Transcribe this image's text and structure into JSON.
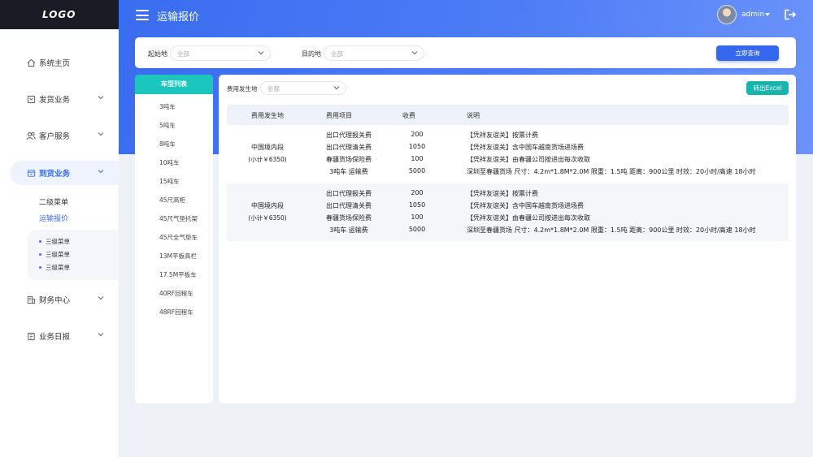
{
  "logo": "LOGO",
  "header": {
    "title": "运输报价",
    "user": "admin"
  },
  "sidebar": {
    "items": [
      {
        "label": "系统主页",
        "icon": "home-icon",
        "has_chevron": false
      },
      {
        "label": "发货业务",
        "icon": "shipping-icon",
        "has_chevron": true
      },
      {
        "label": "客户服务",
        "icon": "users-icon",
        "has_chevron": true
      },
      {
        "label": "到货业务",
        "icon": "arrival-icon",
        "has_chevron": true,
        "active": true
      },
      {
        "label": "财务中心",
        "icon": "finance-icon",
        "has_chevron": true
      },
      {
        "label": "业务日报",
        "icon": "report-icon",
        "has_chevron": true
      }
    ],
    "sub_items": [
      "二级菜单",
      "运输报价"
    ],
    "sub_sub_items": [
      "三级菜单",
      "三级菜单",
      "三级菜单"
    ]
  },
  "filter": {
    "origin_label": "起始地",
    "origin_value": "全部",
    "dest_label": "目的地",
    "dest_value": "全部",
    "query_button": "立即查询"
  },
  "vehicles": {
    "title": "车型列表",
    "items": [
      "3吨车",
      "5吨车",
      "8吨车",
      "10吨车",
      "15吨车",
      "45尺高柜",
      "45尺气垫托架",
      "45尺全气垫车",
      "13M平板高栏",
      "17.5M平板车",
      "40RF回程车",
      "48RF回程车"
    ]
  },
  "main": {
    "location_label": "费用发生地",
    "location_value": "全部",
    "export_button": "转出Excel",
    "columns": [
      "费用发生地",
      "费用项目",
      "收费",
      "说明"
    ],
    "groups": [
      {
        "region": "中国境内段",
        "subtotal": "(小计￥6350)",
        "rows": [
          {
            "item": "出口代理报关费",
            "fee": "200",
            "desc": "【凭祥友谊关】按票计费"
          },
          {
            "item": "出口代理清关费",
            "fee": "1050",
            "desc": "【凭祥友谊关】含中国车越南货场进场费"
          },
          {
            "item": "春疆货场保险费",
            "fee": "100",
            "desc": "【凭祥友谊关】由春疆公司按进出每次收取"
          },
          {
            "item": "3吨车  运输费",
            "fee": "5000",
            "desc": "深圳至春疆货场    尺寸：4.2m*1.8M*2.0M    限重：1.5吨    距离：900公里    时效：20小时/高速  18小时"
          }
        ]
      },
      {
        "region": "中国境内段",
        "subtotal": "(小计￥6350)",
        "rows": [
          {
            "item": "出口代理报关费",
            "fee": "200",
            "desc": "【凭祥友谊关】按票计费"
          },
          {
            "item": "出口代理清关费",
            "fee": "1050",
            "desc": "【凭祥友谊关】含中国车越南货场进场费"
          },
          {
            "item": "春疆货场保险费",
            "fee": "100",
            "desc": "【凭祥友谊关】由春疆公司按进出每次收取"
          },
          {
            "item": "3吨车  运输费",
            "fee": "5000",
            "desc": "深圳至春疆货场    尺寸：4.2m*1.8M*2.0M    限重：1.5吨    距离：900公里    时效：20小时/高速  18小时"
          }
        ]
      }
    ]
  },
  "colors": {
    "primary": "#3d6cf2",
    "teal": "#1bc6bc",
    "dark": "#1b1b26"
  }
}
